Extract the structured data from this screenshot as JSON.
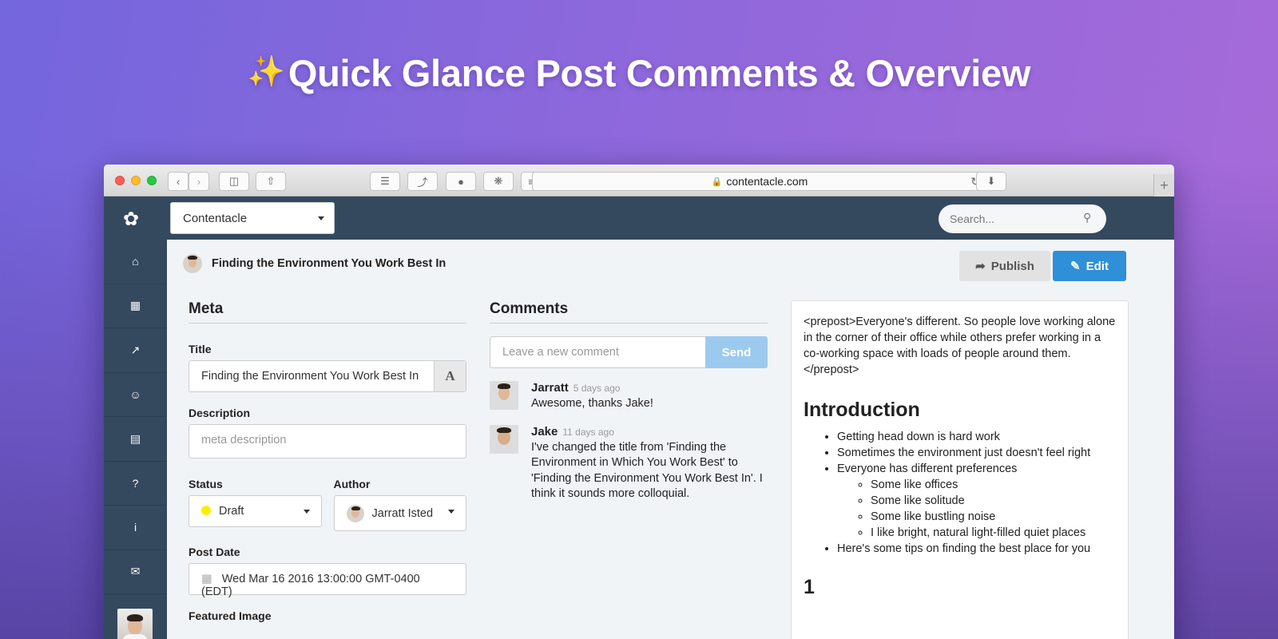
{
  "hero": {
    "sparkle": "✨",
    "title": "Quick Glance Post Comments & Overview"
  },
  "browser": {
    "url": "contentacle.com"
  },
  "topbar": {
    "site_selector": "Contentacle",
    "search_placeholder": "Search..."
  },
  "post": {
    "title": "Finding the Environment You Work Best In",
    "publish_label": "Publish",
    "edit_label": "Edit"
  },
  "meta": {
    "heading": "Meta",
    "title_label": "Title",
    "title_value": "Finding the Environment You Work Best In",
    "title_addon": "A",
    "description_label": "Description",
    "description_placeholder": "meta description",
    "status_label": "Status",
    "status_value": "Draft",
    "status_color": "#ffed00",
    "author_label": "Author",
    "author_value": "Jarratt Isted",
    "post_date_label": "Post Date",
    "post_date_value": "Wed Mar 16 2016 13:00:00 GMT-0400 (EDT)",
    "featured_image_label": "Featured Image"
  },
  "comments": {
    "heading": "Comments",
    "input_placeholder": "Leave a new comment",
    "send_label": "Send",
    "items": [
      {
        "author": "Jarratt",
        "time": "5 days ago",
        "text": "Awesome, thanks Jake!"
      },
      {
        "author": "Jake",
        "time": "11 days ago",
        "text": "I've changed the title from 'Finding the Environment in Which You Work Best' to 'Finding the Environment You Work Best In'. I think it sounds more colloquial."
      }
    ]
  },
  "preview": {
    "prepost": "<prepost>Everyone's different. So people love working alone in the corner of their office while others prefer working in a co-working space with loads of people around them. </prepost>",
    "intro_heading": "Introduction",
    "bullets": [
      "Getting head down is hard work",
      "Sometimes the environment just doesn't feel right",
      "Everyone has different preferences"
    ],
    "sub_bullets": [
      "Some like offices",
      "Some like solitude",
      "Some like bustling noise",
      "I like bright, natural light-filled quiet places"
    ],
    "last_bullet": "Here's some tips on finding the best place for you",
    "section_number": "1"
  },
  "colors": {
    "sidebar": "#34495e",
    "primary": "#2f8fd8",
    "send": "#9ccaef"
  }
}
